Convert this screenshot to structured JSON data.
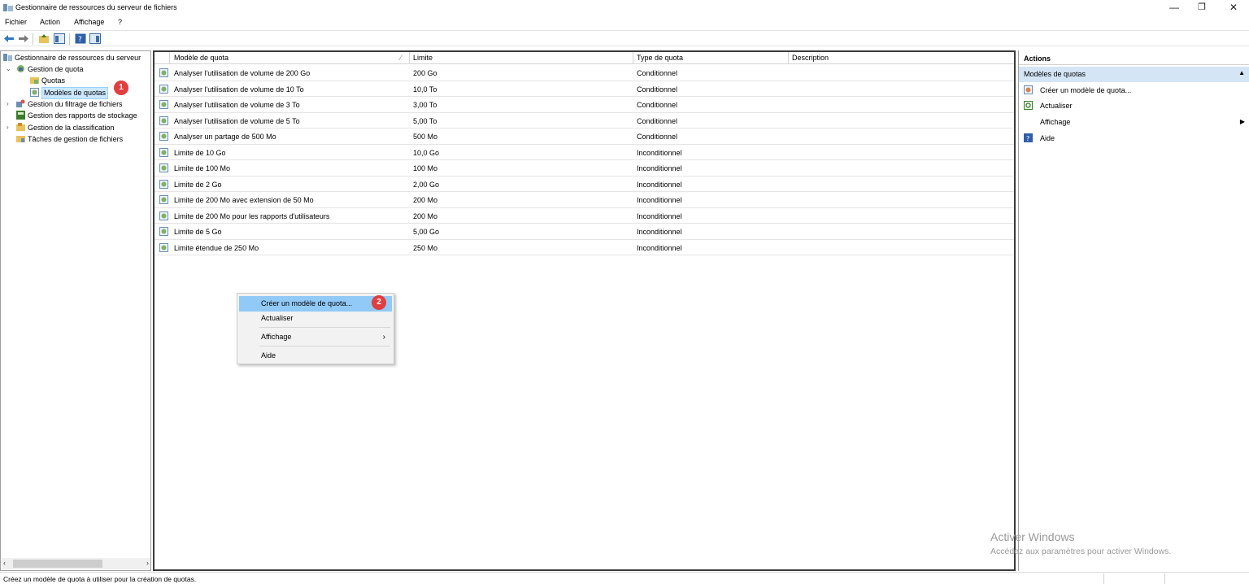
{
  "window": {
    "title": "Gestionnaire de ressources du serveur de fichiers",
    "controls": {
      "minimize": "—",
      "maximize": "❐",
      "close": "✕"
    }
  },
  "menu": [
    "Fichier",
    "Action",
    "Affichage",
    "?"
  ],
  "tree": {
    "items": [
      {
        "label": "Gestionnaire de ressources du serveur",
        "icon": "server-icon"
      },
      {
        "label": "Gestion de quota",
        "icon": "quota-management-icon"
      },
      {
        "label": "Quotas",
        "icon": "folder-quota-icon"
      },
      {
        "label": "Modèles de quotas",
        "icon": "quota-template-icon",
        "selected": true
      },
      {
        "label": "Gestion du filtrage de fichiers",
        "icon": "file-screen-icon"
      },
      {
        "label": "Gestion des rapports de stockage",
        "icon": "storage-report-icon"
      },
      {
        "label": "Gestion de la classification",
        "icon": "classification-icon"
      },
      {
        "label": "Tâches de gestion de fichiers",
        "icon": "file-tasks-icon"
      }
    ],
    "badge": "1"
  },
  "list": {
    "columns": [
      "Modèle de quota",
      "Limite",
      "Type de quota",
      "Description"
    ],
    "rows": [
      {
        "name": "Analyser l'utilisation de volume de 200 Go",
        "limit": "200 Go",
        "type": "Conditionnel"
      },
      {
        "name": "Analyser l'utilisation de volume de 10 To",
        "limit": "10,0 To",
        "type": "Conditionnel"
      },
      {
        "name": "Analyser l'utilisation de volume de 3 To",
        "limit": "3,00 To",
        "type": "Conditionnel"
      },
      {
        "name": "Analyser l'utilisation de volume de 5 To",
        "limit": "5,00 To",
        "type": "Conditionnel"
      },
      {
        "name": "Analyser un partage de 500 Mo",
        "limit": "500 Mo",
        "type": "Conditionnel"
      },
      {
        "name": "Limite de 10 Go",
        "limit": "10,0 Go",
        "type": "Inconditionnel"
      },
      {
        "name": "Limite de 100 Mo",
        "limit": "100 Mo",
        "type": "Inconditionnel"
      },
      {
        "name": "Limite de 2 Go",
        "limit": "2,00 Go",
        "type": "Inconditionnel"
      },
      {
        "name": "Limite de 200 Mo avec extension de 50 Mo",
        "limit": "200 Mo",
        "type": "Inconditionnel"
      },
      {
        "name": "Limite de 200 Mo pour les rapports d'utilisateurs",
        "limit": "200 Mo",
        "type": "Inconditionnel"
      },
      {
        "name": "Limite de 5 Go",
        "limit": "5,00 Go",
        "type": "Inconditionnel"
      },
      {
        "name": "Limite étendue de 250 Mo",
        "limit": "250 Mo",
        "type": "Inconditionnel"
      }
    ]
  },
  "context_menu": {
    "items": [
      "Créer un modèle de quota...",
      "Actualiser",
      "Affichage",
      "Aide"
    ],
    "badge": "2"
  },
  "actions": {
    "title": "Actions",
    "section": "Modèles de quotas",
    "items": [
      {
        "label": "Créer un modèle de quota...",
        "icon": "new-template-icon"
      },
      {
        "label": "Actualiser",
        "icon": "refresh-icon"
      },
      {
        "label": "Affichage",
        "icon": ""
      },
      {
        "label": "Aide",
        "icon": "help-icon"
      }
    ]
  },
  "watermark": {
    "line1": "Activer Windows",
    "line2": "Accédez aux paramètres pour activer Windows."
  },
  "status": "Créez un modèle de quota à utiliser pour la création de quotas."
}
